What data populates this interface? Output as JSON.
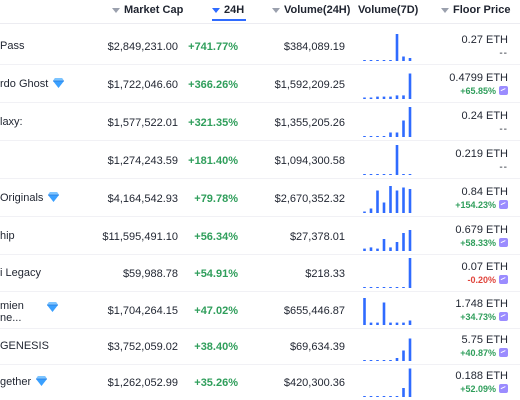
{
  "header": {
    "market_cap": "Market Cap",
    "change_24h": "24H",
    "volume_24h": "Volume(24H)",
    "volume_7d": "Volume(7D)",
    "floor_price": "Floor Price"
  },
  "rows": [
    {
      "name": "Pass",
      "verified": false,
      "market_cap": "$2,849,231.00",
      "change": "+741.77%",
      "volume": "$384,089.19",
      "floor": "0.27 ETH",
      "floor_change": "--",
      "floor_dir": "nil",
      "spark": [
        0,
        0,
        0,
        0,
        0,
        0.9,
        0.15,
        0.1
      ]
    },
    {
      "name": "rdo Ghost",
      "verified": true,
      "market_cap": "$1,722,046.60",
      "change": "+366.26%",
      "volume": "$1,592,209.25",
      "floor": "0.4799 ETH",
      "floor_change": "+65.85%",
      "floor_dir": "pos",
      "spark": [
        0.05,
        0.05,
        0.08,
        0.08,
        0.08,
        0.12,
        0.12,
        0.85
      ]
    },
    {
      "name": "laxy:",
      "verified": false,
      "market_cap": "$1,577,522.01",
      "change": "+321.35%",
      "volume": "$1,355,205.26",
      "floor": "0.24 ETH",
      "floor_change": "--",
      "floor_dir": "nil",
      "spark": [
        0,
        0,
        0,
        0,
        0.15,
        0.15,
        0.55,
        1
      ]
    },
    {
      "name": "",
      "verified": false,
      "market_cap": "$1,274,243.59",
      "change": "+181.40%",
      "volume": "$1,094,300.58",
      "floor": "0.219 ETH",
      "floor_change": "--",
      "floor_dir": "nil",
      "spark": [
        0,
        0,
        0,
        0,
        0,
        1,
        0,
        0
      ]
    },
    {
      "name": "Originals",
      "verified": true,
      "market_cap": "$4,164,542.93",
      "change": "+79.78%",
      "volume": "$2,670,352.32",
      "floor": "0.84 ETH",
      "floor_change": "+154.23%",
      "floor_dir": "pos",
      "spark": [
        0.05,
        0.15,
        0.75,
        0.35,
        0.9,
        0.75,
        0.85,
        0.8
      ]
    },
    {
      "name": "hip",
      "verified": false,
      "market_cap": "$11,595,491.10",
      "change": "+56.34%",
      "volume": "$27,378.01",
      "floor": "0.679 ETH",
      "floor_change": "+58.33%",
      "floor_dir": "pos",
      "spark": [
        0.08,
        0.12,
        0.08,
        0.4,
        0.12,
        0.3,
        0.6,
        0.7
      ]
    },
    {
      "name": "i Legacy",
      "verified": false,
      "market_cap": "$59,988.78",
      "change": "+54.91%",
      "volume": "$218.33",
      "floor": "0.07 ETH",
      "floor_change": "-0.20%",
      "floor_dir": "neg",
      "spark": [
        0,
        0,
        0,
        0,
        0,
        0,
        0,
        1
      ]
    },
    {
      "name": "mien\nne...",
      "verified": true,
      "market_cap": "$1,704,264.15",
      "change": "+47.02%",
      "volume": "$655,446.87",
      "floor": "1.748 ETH",
      "floor_change": "+34.73%",
      "floor_dir": "pos",
      "spark": [
        0.9,
        0.08,
        0.08,
        0.75,
        0.08,
        0.08,
        0.08,
        0.15
      ]
    },
    {
      "name": "GENESIS",
      "verified": false,
      "market_cap": "$3,752,059.02",
      "change": "+38.40%",
      "volume": "$69,634.39",
      "floor": "5.75 ETH",
      "floor_change": "+40.87%",
      "floor_dir": "pos",
      "spark": [
        0,
        0,
        0,
        0,
        0,
        0.1,
        0.35,
        0.75
      ]
    },
    {
      "name": "gether",
      "verified": true,
      "market_cap": "$1,262,052.99",
      "change": "+35.26%",
      "volume": "$420,300.36",
      "floor": "0.188 ETH",
      "floor_change": "+52.09%",
      "floor_dir": "pos",
      "spark": [
        0,
        0,
        0,
        0,
        0,
        0,
        0.3,
        0.95
      ]
    }
  ]
}
